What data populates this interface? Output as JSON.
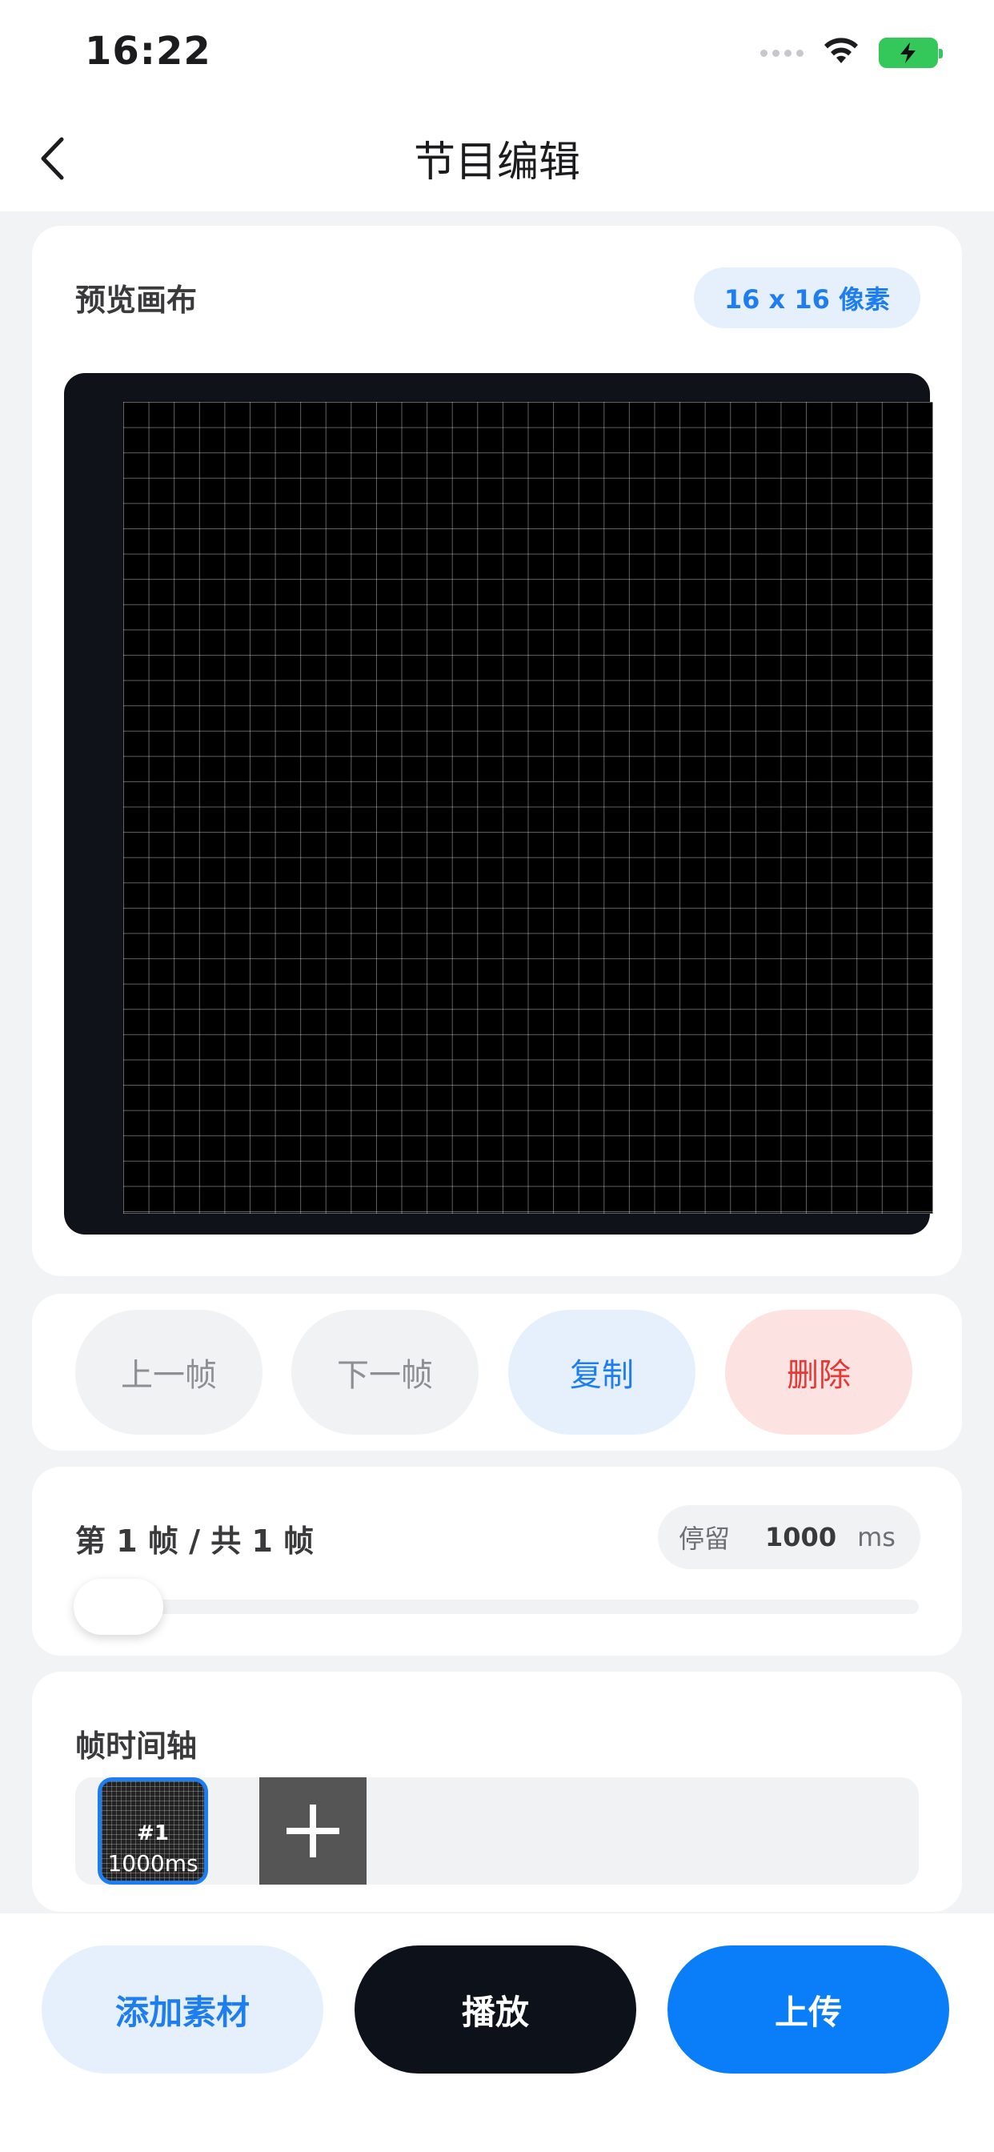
{
  "status_bar": {
    "time": "16:22"
  },
  "nav": {
    "title": "节目编辑"
  },
  "preview": {
    "title": "预览画布",
    "size_badge": "16 x 16 像素"
  },
  "controls": {
    "prev_label": "上一帧",
    "next_label": "下一帧",
    "copy_label": "复制",
    "delete_label": "删除"
  },
  "frame_info": {
    "position_text": "第 1 帧 / 共 1 帧",
    "dwell_label": "停留",
    "dwell_value": "1000",
    "dwell_unit": "ms",
    "slider_value": 1
  },
  "timeline": {
    "title": "帧时间轴",
    "frames": [
      {
        "index": "#1",
        "duration": "1000ms",
        "selected": true
      }
    ]
  },
  "actions": {
    "add_material": "添加素材",
    "play": "播放",
    "upload": "上传"
  },
  "colors": {
    "accent": "#1e7ef0",
    "primary_button": "#0a7ef8",
    "dark_button": "#0c111a",
    "danger": "#e53935",
    "battery": "#34c759"
  },
  "icons": [
    "back-chevron-icon",
    "signal-icon",
    "wifi-icon",
    "battery-charging-icon",
    "plus-icon"
  ]
}
